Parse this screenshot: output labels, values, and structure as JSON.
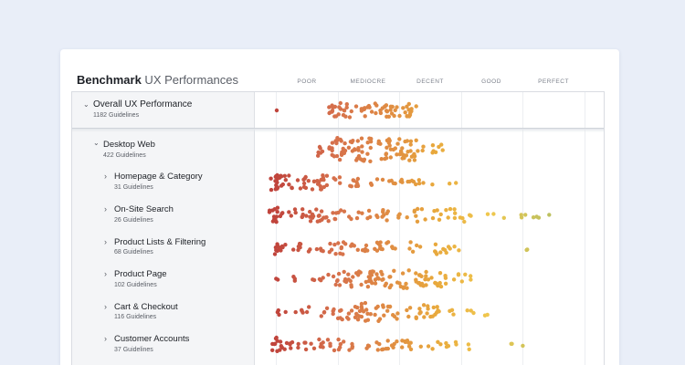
{
  "header": {
    "title_bold": "Benchmark",
    "title_rest": " UX Performances"
  },
  "scale": [
    "POOR",
    "MEDIOCRE",
    "DECENT",
    "GOOD",
    "PERFECT"
  ],
  "colors": {
    "poor": "#c0443c",
    "mediocre": "#d9814a",
    "decent": "#e7a53e",
    "good": "#f0c84e",
    "perfect": "#b9c061"
  },
  "icons": {
    "collapsed": "chevron-right-icon",
    "expanded": "chevron-down-icon"
  },
  "rows": [
    {
      "label": "Overall UX Performance",
      "count": "1182 Guidelines",
      "expanded": true
    },
    {
      "label": "Desktop Web",
      "count": "422 Guidelines",
      "expanded": true
    },
    {
      "label": "Homepage & Category",
      "count": "31 Guidelines",
      "expanded": false
    },
    {
      "label": "On-Site Search",
      "count": "26 Guidelines",
      "expanded": false
    },
    {
      "label": "Product Lists & Filtering",
      "count": "68 Guidelines",
      "expanded": false
    },
    {
      "label": "Product Page",
      "count": "102 Guidelines",
      "expanded": false
    },
    {
      "label": "Cart & Checkout",
      "count": "116 Guidelines",
      "expanded": false
    },
    {
      "label": "Customer Accounts",
      "count": "37 Guidelines",
      "expanded": false
    }
  ]
}
